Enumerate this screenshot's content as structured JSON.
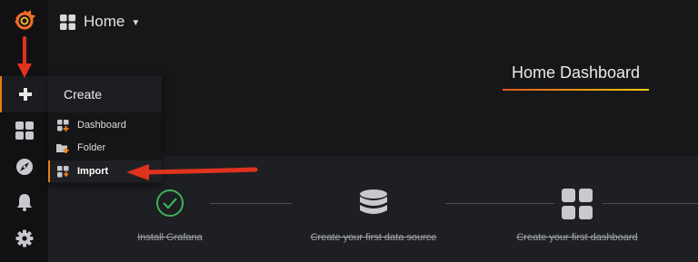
{
  "topnav": {
    "title": "Home",
    "icon": "dashboard-grid-icon"
  },
  "dashboard": {
    "title": "Home Dashboard"
  },
  "sidebar": {
    "items": [
      {
        "name": "grafana-logo",
        "icon": "grafana-logo-icon"
      },
      {
        "name": "create",
        "icon": "plus-icon"
      },
      {
        "name": "dashboards",
        "icon": "dashboard-grid-icon"
      },
      {
        "name": "explore",
        "icon": "compass-icon"
      },
      {
        "name": "alerting",
        "icon": "bell-icon"
      },
      {
        "name": "configuration",
        "icon": "gear-icon"
      }
    ]
  },
  "create_menu": {
    "title": "Create",
    "items": [
      {
        "label": "Dashboard",
        "icon": "dashboard-add-icon"
      },
      {
        "label": "Folder",
        "icon": "folder-add-icon"
      },
      {
        "label": "Import",
        "icon": "import-icon"
      }
    ]
  },
  "getting_started": {
    "steps": [
      {
        "label": "Install Grafana",
        "icon": "check-circle-icon",
        "done": true
      },
      {
        "label": "Create your first data source",
        "icon": "database-icon",
        "done": true
      },
      {
        "label": "Create your first dashboard",
        "icon": "dashboard-grid-icon",
        "done": true
      }
    ]
  },
  "colors": {
    "accent": "#eb7b18",
    "arrow": "#e0321e",
    "success": "#3eb15b",
    "panel": "#1e1f22",
    "background": "#161719"
  }
}
